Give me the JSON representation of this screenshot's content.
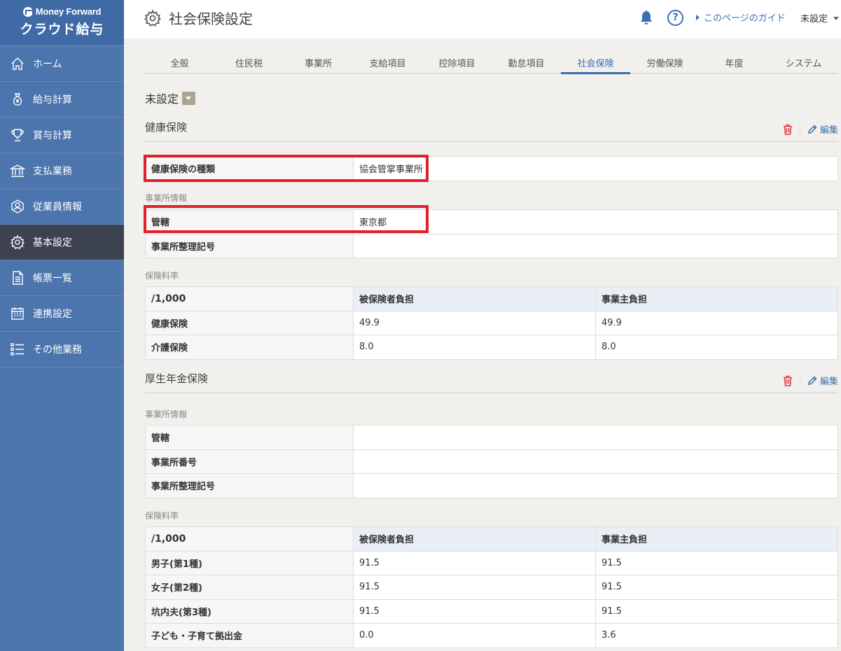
{
  "logo": {
    "brand": "Money Forward",
    "product": "クラウド給与"
  },
  "sidebar": {
    "items": [
      {
        "label": "ホーム",
        "icon": "home-icon"
      },
      {
        "label": "給与計算",
        "icon": "money-bag-icon"
      },
      {
        "label": "賞与計算",
        "icon": "trophy-icon"
      },
      {
        "label": "支払業務",
        "icon": "bank-icon"
      },
      {
        "label": "従業員情報",
        "icon": "employee-icon"
      },
      {
        "label": "基本設定",
        "icon": "gear-icon"
      },
      {
        "label": "帳票一覧",
        "icon": "document-icon"
      },
      {
        "label": "連携設定",
        "icon": "calendar-icon"
      },
      {
        "label": "その他業務",
        "icon": "list-icon"
      }
    ],
    "active_index": 5
  },
  "header": {
    "title": "社会保険設定",
    "guide_link": "このページのガイド",
    "user": "未設定"
  },
  "tabs": [
    "全般",
    "住民税",
    "事業所",
    "支給項目",
    "控除項目",
    "勤怠項目",
    "社会保険",
    "労働保険",
    "年度",
    "システム"
  ],
  "active_tab": "社会保険",
  "status": "未設定",
  "actions": {
    "edit": "編集"
  },
  "health": {
    "title": "健康保険",
    "type_label": "健康保険の種類",
    "type_value": "協会管掌事業所",
    "office_info_label": "事業所情報",
    "jurisdiction_label": "管轄",
    "jurisdiction_value": "東京都",
    "office_code_label": "事業所整理記号",
    "office_code_value": "",
    "rate_label": "保険料率",
    "rate_header": {
      "unit": "/1,000",
      "insured": "被保険者負担",
      "employer": "事業主負担"
    },
    "rates": [
      {
        "name": "健康保険",
        "insured": "49.9",
        "employer": "49.9"
      },
      {
        "name": "介護保険",
        "insured": "8.0",
        "employer": "8.0"
      }
    ]
  },
  "pension": {
    "title": "厚生年金保険",
    "office_info_label": "事業所情報",
    "jurisdiction_label": "管轄",
    "jurisdiction_value": "",
    "office_number_label": "事業所番号",
    "office_number_value": "",
    "office_code_label": "事業所整理記号",
    "office_code_value": "",
    "rate_label": "保険料率",
    "rate_header": {
      "unit": "/1,000",
      "insured": "被保険者負担",
      "employer": "事業主負担"
    },
    "rates": [
      {
        "name": "男子(第1種)",
        "insured": "91.5",
        "employer": "91.5"
      },
      {
        "name": "女子(第2種)",
        "insured": "91.5",
        "employer": "91.5"
      },
      {
        "name": "坑内夫(第3種)",
        "insured": "91.5",
        "employer": "91.5"
      },
      {
        "name": "子ども・子育て拠出金",
        "insured": "0.0",
        "employer": "3.6"
      }
    ]
  },
  "colors": {
    "sidebar": "#4c74ad",
    "accent": "#3a6fb8",
    "highlight": "#e0202b",
    "delete": "#d9434d"
  }
}
